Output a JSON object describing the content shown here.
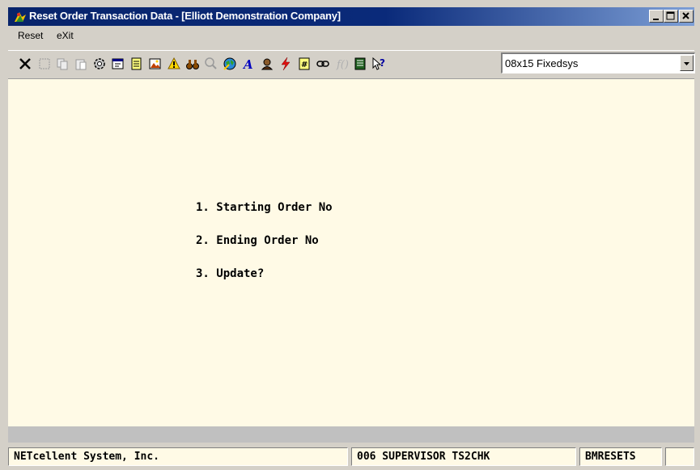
{
  "window": {
    "title": "Reset Order Transaction Data - [Elliott Demonstration Company]",
    "controls": [
      "minimize-icon",
      "maximize-icon",
      "close-icon"
    ]
  },
  "menu": {
    "items": [
      {
        "label": "Reset"
      },
      {
        "label": "eXit"
      }
    ]
  },
  "toolbar": {
    "icons": [
      "close-icon",
      "blank-icon",
      "copy-icon",
      "paste-icon",
      "gear-icon",
      "properties-icon",
      "note-icon",
      "image-icon",
      "warning-icon",
      "binoculars-icon",
      "magnifier-icon",
      "globe-icon",
      "font-icon",
      "user-icon",
      "lightning-icon",
      "calculator-icon",
      "link-icon",
      "function-icon",
      "notebook-icon",
      "help-pointer-icon"
    ],
    "font_select": "08x15 Fixedsys"
  },
  "form": {
    "fields": [
      {
        "label": "1. Starting Order No"
      },
      {
        "label": "2. Ending Order No"
      },
      {
        "label": "3. Update?"
      }
    ]
  },
  "status": {
    "company": "NETcellent System, Inc.",
    "user": "006 SUPERVISOR TS2CHK",
    "program": "BMRESETS"
  },
  "colors": {
    "title_bar": "#08246b",
    "content_bg": "#fffae6",
    "chrome": "#d4d0c8"
  }
}
